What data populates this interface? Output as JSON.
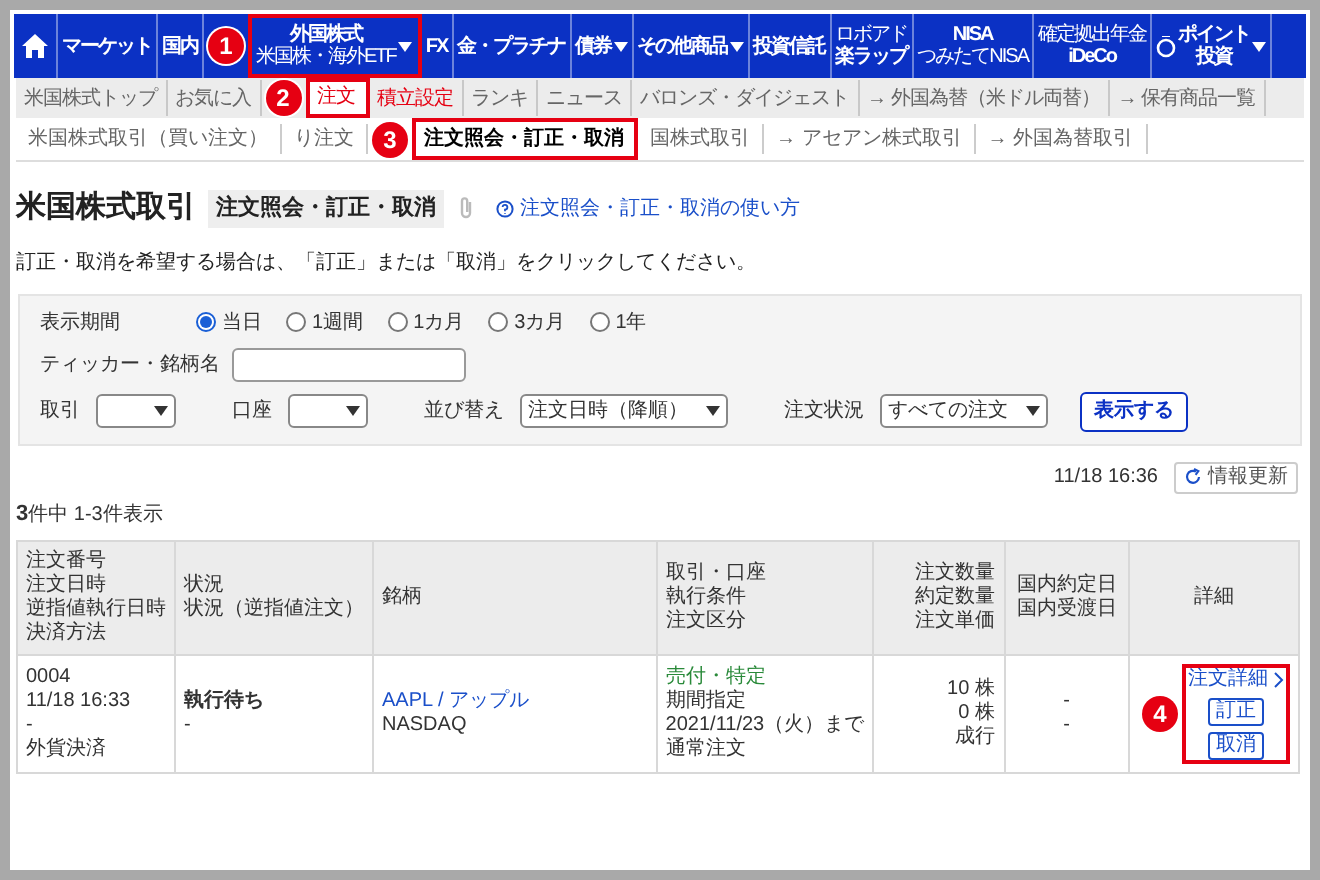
{
  "main_nav": [
    {
      "kind": "plain",
      "label": "マーケット"
    },
    {
      "kind": "plain",
      "label": "国内"
    },
    {
      "kind": "sub",
      "label": "外国株式",
      "sublabel": "米国株・海外ETF",
      "dropdown": true,
      "callout": "1"
    },
    {
      "kind": "plain",
      "label": "FX"
    },
    {
      "kind": "plain",
      "label": "金・プラチナ"
    },
    {
      "kind": "plain",
      "label": "債券",
      "dropdown": true
    },
    {
      "kind": "plain",
      "label": "その他商品",
      "dropdown": true
    },
    {
      "kind": "plain",
      "label": "投資信託"
    },
    {
      "kind": "over",
      "label": "楽ラップ",
      "overline": "ロボアド"
    },
    {
      "kind": "sub",
      "label": "NISA",
      "sublabel": "つみたてNISA"
    },
    {
      "kind": "over",
      "label": "iDeCo",
      "overline": "確定拠出年金"
    },
    {
      "kind": "point",
      "label": "ポイント",
      "sublabel": "投資",
      "dropdown": true
    }
  ],
  "sub_nav": [
    {
      "label": "米国株式トップ",
      "selected": false,
      "highlighted": false
    },
    {
      "label": "お気に入",
      "selected": false,
      "highlighted": false
    },
    {
      "label": "注文",
      "selected": true,
      "highlighted": true,
      "callout": "2"
    },
    {
      "label": "積立設定",
      "selected": false,
      "highlighted": true
    },
    {
      "label": "ランキ",
      "selected": false,
      "highlighted": false
    },
    {
      "label": "ニュース",
      "selected": false,
      "highlighted": false
    },
    {
      "label": "バロンズ・ダイジェスト",
      "selected": false,
      "highlighted": false
    },
    {
      "label": "→ 外国為替（米ドル両替）",
      "selected": false,
      "highlighted": false
    },
    {
      "label": "→ 保有商品一覧",
      "selected": false,
      "highlighted": false
    }
  ],
  "order_nav": [
    {
      "label": "米国株式取引（買い注文）",
      "selected": false
    },
    {
      "label": "り注文",
      "selected": false
    },
    {
      "label": "注文照会・訂正・取消",
      "selected": true,
      "callout": "3"
    },
    {
      "label": "国株式取引",
      "selected": false
    },
    {
      "label": "→ アセアン株式取引",
      "selected": false
    },
    {
      "label": "→ 外国為替取引",
      "selected": false
    }
  ],
  "page": {
    "title": "米国株式取引",
    "subtitle": "注文照会・訂正・取消",
    "help_link": "注文照会・訂正・取消の使い方",
    "instruction": "訂正・取消を希望する場合は、「訂正」または「取消」をクリックしてください。"
  },
  "filters": {
    "period_label": "表示期間",
    "periods": [
      {
        "label": "当日",
        "selected": true
      },
      {
        "label": "1週間",
        "selected": false
      },
      {
        "label": "1カ月",
        "selected": false
      },
      {
        "label": "3カ月",
        "selected": false
      },
      {
        "label": "1年",
        "selected": false
      }
    ],
    "ticker_label": "ティッカー・銘柄名",
    "selects": [
      {
        "label": "取引"
      },
      {
        "label": "口座"
      },
      {
        "label": "並び替え",
        "value": "注文日時（降順）"
      },
      {
        "label": "注文状況",
        "value": "すべての注文"
      }
    ],
    "submit": "表示する"
  },
  "updated_at": "11/18 16:36",
  "refresh_button": "情報更新",
  "count": {
    "total": "3",
    "text": "件中 1-3件表示"
  },
  "table": {
    "columns": [
      [
        "注文番号",
        "注文日時",
        "逆指値執行日時",
        "決済方法"
      ],
      [
        "状況",
        "状況（逆指値注文）"
      ],
      [
        "銘柄"
      ],
      [
        "取引・口座",
        "執行条件",
        "注文区分"
      ],
      [
        "注文数量",
        "約定数量",
        "注文単価"
      ],
      [
        "国内約定日",
        "国内受渡日"
      ],
      [
        "詳細"
      ]
    ],
    "rows": [
      {
        "order": [
          "0004",
          "11/18  16:33",
          "-",
          "外貨決済"
        ],
        "status": [
          "執行待ち",
          "-"
        ],
        "symbol": "AAPL / アップル",
        "market": "NASDAQ",
        "trade": "売付・特定",
        "conditions": [
          "期間指定",
          "2021/11/23（火）まで",
          "通常注文"
        ],
        "quantities": [
          {
            "value": "10",
            "unit": "株"
          },
          {
            "value": "0",
            "unit": "株"
          },
          {
            "value": "成行"
          }
        ],
        "dates": [
          "-",
          "-"
        ],
        "detail_link": "注文詳細",
        "actions": [
          "訂正",
          "取消"
        ],
        "callout": "4"
      }
    ]
  }
}
